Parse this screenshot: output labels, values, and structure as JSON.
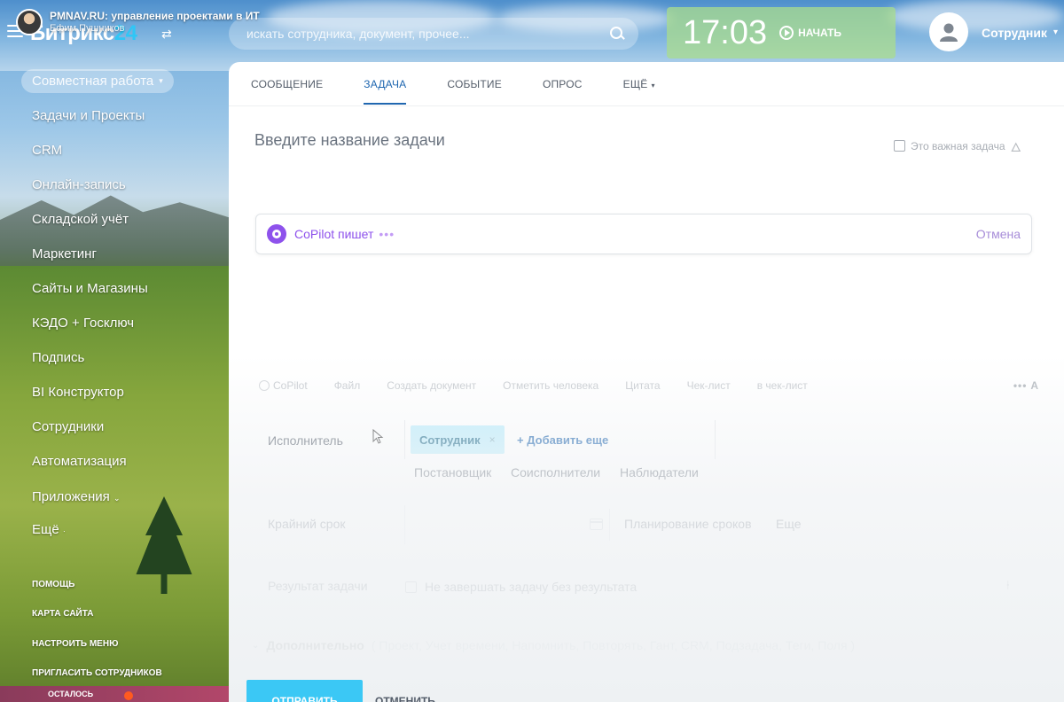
{
  "video": {
    "title": "PMNAV.RU: управление проектами в ИТ",
    "subtitle": "Ефим Пушников"
  },
  "header": {
    "logo_text": "Битрикс",
    "logo_num": "24",
    "search_placeholder": "искать сотрудника, документ, прочее...",
    "clock": "17:03",
    "start_label": "НАЧАТЬ",
    "user_name": "Сотрудник"
  },
  "sidebar": {
    "items": [
      {
        "label": "Совместная работа"
      },
      {
        "label": "Задачи и Проекты"
      },
      {
        "label": "CRM"
      },
      {
        "label": "Онлайн-запись"
      },
      {
        "label": "Складской учёт"
      },
      {
        "label": "Маркетинг"
      },
      {
        "label": "Сайты и Магазины"
      },
      {
        "label": "КЭДО + Госключ"
      },
      {
        "label": "Подпись"
      },
      {
        "label": "BI Конструктор"
      },
      {
        "label": "Сотрудники"
      },
      {
        "label": "Автоматизация"
      },
      {
        "label": "Приложения"
      },
      {
        "label": "Ещё"
      }
    ],
    "sub_items": [
      {
        "label": "ПОМОЩЬ"
      },
      {
        "label": "КАРТА САЙТА"
      },
      {
        "label": "НАСТРОИТЬ МЕНЮ"
      },
      {
        "label": "ПРИГЛАСИТЬ СОТРУДНИКОВ"
      }
    ],
    "bottom_label": "ОСТАЛОСЬ"
  },
  "panel": {
    "tabs": [
      {
        "label": "СООБЩЕНИЕ"
      },
      {
        "label": "ЗАДАЧА"
      },
      {
        "label": "СОБЫТИЕ"
      },
      {
        "label": "ОПРОС"
      },
      {
        "label": "ЕЩЁ"
      }
    ],
    "active_tab": "ЗАДАЧА",
    "task_title_placeholder": "Введите название задачи",
    "important_label": "Это важная задача",
    "copilot": {
      "label": "CoPilot пишет",
      "cancel": "Отмена"
    },
    "toolbar": [
      {
        "label": "CoPilot"
      },
      {
        "label": "Файл"
      },
      {
        "label": "Создать документ"
      },
      {
        "label": "Отметить человека"
      },
      {
        "label": "Цитата"
      },
      {
        "label": "Чек-лист"
      },
      {
        "label": "в чек-лист"
      }
    ],
    "executor": {
      "label": "Исполнитель",
      "tag": "Сотрудник",
      "add_more": "Добавить еще",
      "roles": [
        "Постановщик",
        "Соисполнители",
        "Наблюдатели"
      ]
    },
    "deadline": {
      "label": "Крайний срок",
      "planning": "Планирование сроков",
      "more": "Еще"
    },
    "result": {
      "label": "Результат задачи",
      "checkbox_label": "Не завершать задачу без результата"
    },
    "extra": {
      "title": "Дополнительно",
      "list": "( Проект,  Учет времени,  Напомнить,  Повторять,  Гант,  CRM,  Подзадача,  Теги,  Поля )"
    },
    "submit_label": "ОТПРАВИТЬ",
    "cancel_label": "ОТМЕНИТЬ"
  },
  "colors": {
    "accent_blue": "#2067b0",
    "copilot_purple": "#8e52ec",
    "executor_tag_bg": "#bcedfc",
    "submit_bg": "#3bc8f5",
    "clock_bg": "#aadc8c"
  }
}
